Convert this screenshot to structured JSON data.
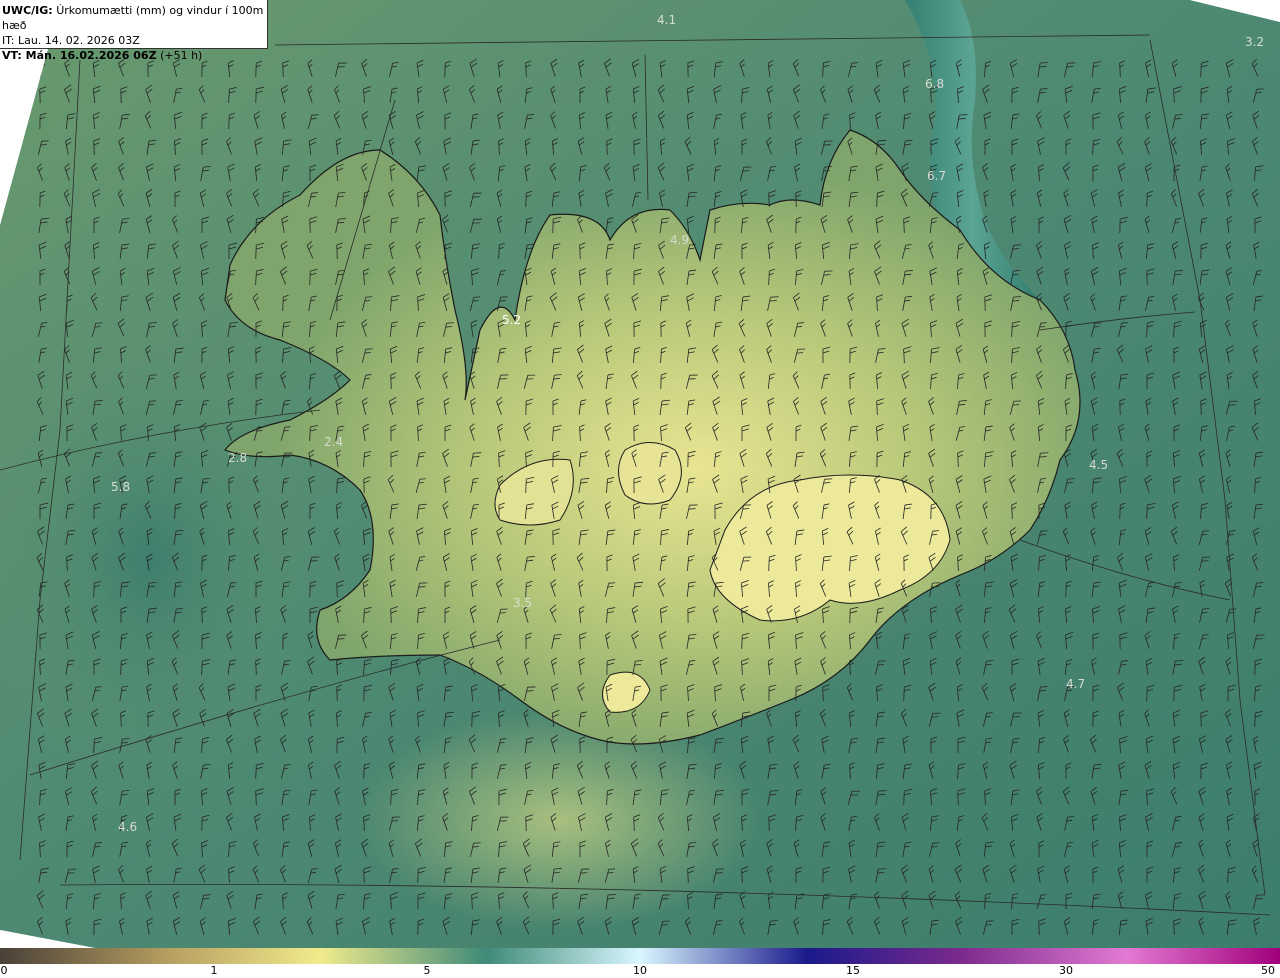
{
  "header": {
    "product": "UWC/IG:",
    "title": "Úrkomumætti (mm) og vindur í 100m hæð",
    "init_label": "IT:",
    "init_time": "Lau. 14. 02. 2026 03Z",
    "valid_label": "VT: Mán. 16.02.2026 06Z",
    "valid_offset": "(+51 h)"
  },
  "values": [
    {
      "id": "v1",
      "text": "4.1"
    },
    {
      "id": "v2",
      "text": "3.2"
    },
    {
      "id": "v3",
      "text": "6.8"
    },
    {
      "id": "v4",
      "text": "6.7"
    },
    {
      "id": "v5",
      "text": "4.9"
    },
    {
      "id": "v6",
      "text": "5.2"
    },
    {
      "id": "v7",
      "text": "2.8"
    },
    {
      "id": "v8",
      "text": "2.4"
    },
    {
      "id": "v9",
      "text": "5.8"
    },
    {
      "id": "v10",
      "text": "4.5"
    },
    {
      "id": "v11",
      "text": "3.5"
    },
    {
      "id": "v12",
      "text": "4.7"
    },
    {
      "id": "v13",
      "text": "4.6"
    }
  ],
  "colorbar": {
    "ticks": [
      "0",
      "1",
      "5",
      "10",
      "15",
      "30",
      "50"
    ],
    "colors": [
      "#4a4038",
      "#b59d5f",
      "#f1eb8c",
      "#3f8a78",
      "#d9f7ff",
      "#1a1a8c",
      "#7a2a8c",
      "#e27ad2",
      "#a0007a"
    ]
  },
  "colors": {
    "ocean": "#3f7f6c",
    "land": "#9fb86a",
    "high_precip": "#e2e08c",
    "lines": "#1b1b1b"
  }
}
